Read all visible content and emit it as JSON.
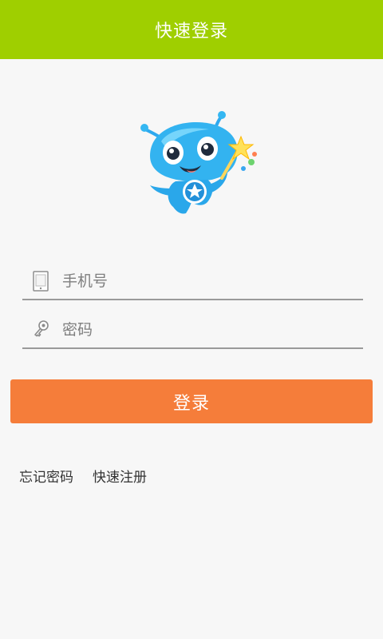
{
  "header": {
    "title": "快速登录",
    "color": "#9fcf00"
  },
  "mascot": {
    "icon": "blue-alien-mascot-icon",
    "color": "#2ea9ef"
  },
  "form": {
    "phone": {
      "placeholder": "手机号",
      "icon": "phone-icon"
    },
    "password": {
      "placeholder": "密码",
      "icon": "key-icon"
    }
  },
  "login_button": {
    "label": "登录",
    "color": "#f57d3a"
  },
  "links": {
    "forgot_password": "忘记密码",
    "quick_register": "快速注册"
  }
}
